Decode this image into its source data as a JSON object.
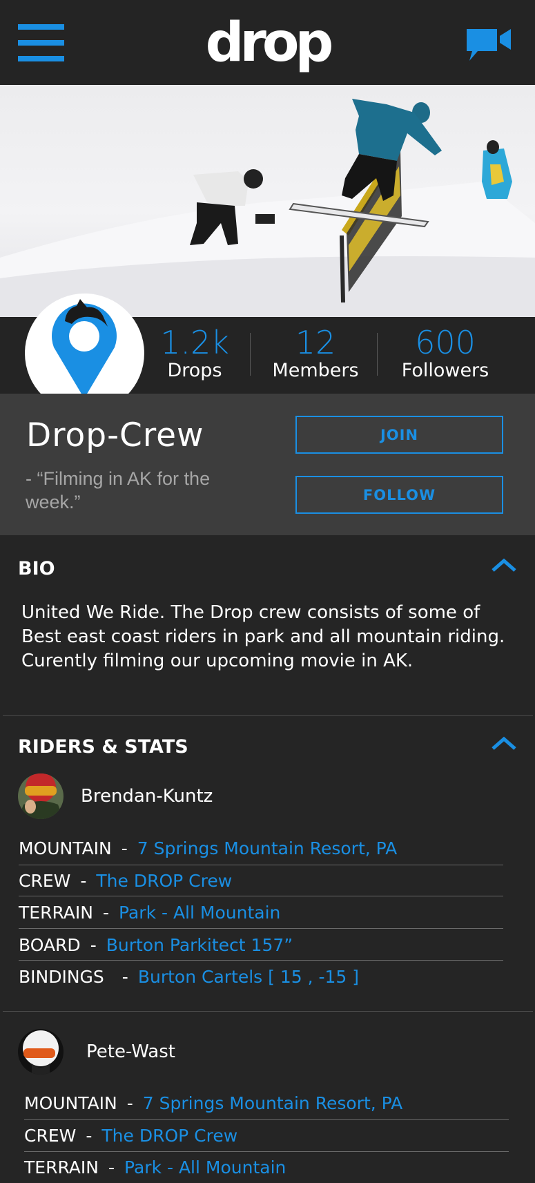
{
  "app": {
    "logo": "drop"
  },
  "icons": {
    "menu": "hamburger-menu-icon",
    "video": "video-camera-icon",
    "collapse": "chevron-up-icon",
    "crew_avatar": "map-pin-icon"
  },
  "colors": {
    "accent": "#1a8fe3",
    "background": "#252525",
    "panel": "#3d3d3d"
  },
  "stats": [
    {
      "value": "1.2k",
      "label": "Drops"
    },
    {
      "value": "12",
      "label": "Members"
    },
    {
      "value": "600",
      "label": "Followers"
    }
  ],
  "crew": {
    "name": "Drop-Crew",
    "status": "- “Filming in AK for the week.”",
    "join_label": "JOIN",
    "follow_label": "FOLLOW"
  },
  "bio": {
    "title": "BIO",
    "text": "United We Ride. The Drop crew consists of some of Best east coast riders in park and all mountain riding. Curently filming our upcoming movie in AK."
  },
  "riders_section": {
    "title": "RIDERS & STATS"
  },
  "riders": [
    {
      "name": "Brendan-Kuntz",
      "stats": [
        {
          "key": "MOUNTAIN",
          "value": "7 Springs Mountain Resort, PA"
        },
        {
          "key": "CREW",
          "value": "The DROP Crew"
        },
        {
          "key": "TERRAIN",
          "value": "Park - All Mountain"
        },
        {
          "key": "BOARD",
          "value": "Burton Parkitect 157”"
        },
        {
          "key": "BINDINGS",
          "value": "Burton Cartels [ 15 , -15 ]"
        }
      ]
    },
    {
      "name": "Pete-Wast",
      "stats": [
        {
          "key": "MOUNTAIN",
          "value": "7 Springs Mountain Resort, PA"
        },
        {
          "key": "CREW",
          "value": "The DROP Crew"
        },
        {
          "key": "TERRAIN",
          "value": "Park - All Mountain"
        }
      ]
    }
  ]
}
